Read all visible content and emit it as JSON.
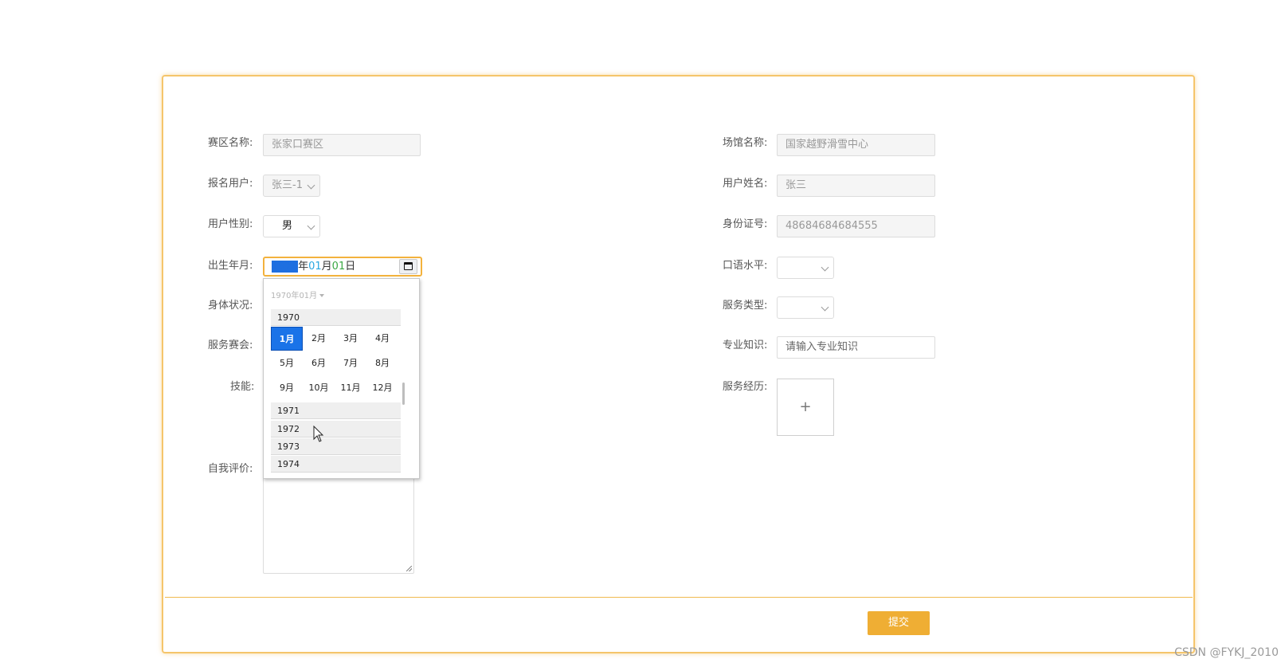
{
  "form": {
    "left": {
      "region": {
        "label": "赛区名称:",
        "value": "张家口赛区"
      },
      "reg_user": {
        "label": "报名用户:",
        "value": "张三-1"
      },
      "gender": {
        "label": "用户性别:",
        "value": "男"
      },
      "birth": {
        "label": "出生年月:",
        "year": "1970",
        "year_suffix": "年",
        "month": "01",
        "month_suffix": "月",
        "day": "01",
        "day_suffix": "日"
      },
      "health": {
        "label": "身体状况:"
      },
      "service_event": {
        "label": "服务赛会:"
      },
      "skills": {
        "label": "技能:"
      },
      "self_eval": {
        "label": "自我评价:"
      }
    },
    "right": {
      "venue": {
        "label": "场馆名称:",
        "value": "国家越野滑雪中心"
      },
      "user_name": {
        "label": "用户姓名:",
        "value": "张三"
      },
      "id_no": {
        "label": "身份证号:",
        "value": "48684684684555"
      },
      "oral": {
        "label": "口语水平:",
        "value": ""
      },
      "service_type": {
        "label": "服务类型:",
        "value": ""
      },
      "expertise": {
        "label": "专业知识:",
        "placeholder": "请输入专业知识"
      },
      "experience": {
        "label": "服务经历:",
        "upload_symbol": "+"
      }
    }
  },
  "date_picker": {
    "header": "1970年01月",
    "current_year": "1970",
    "months": [
      "1月",
      "2月",
      "3月",
      "4月",
      "5月",
      "6月",
      "7月",
      "8月",
      "9月",
      "10月",
      "11月",
      "12月"
    ],
    "selected_month": "1月",
    "more_years": [
      "1971",
      "1972",
      "1973",
      "1974"
    ]
  },
  "footer": {
    "submit_label": "提交"
  },
  "watermark": "CSDN @FYKJ_2010",
  "colors": {
    "accent": "#f5c56b",
    "submit": "#efae34",
    "selected_month": "#1a73e8"
  }
}
